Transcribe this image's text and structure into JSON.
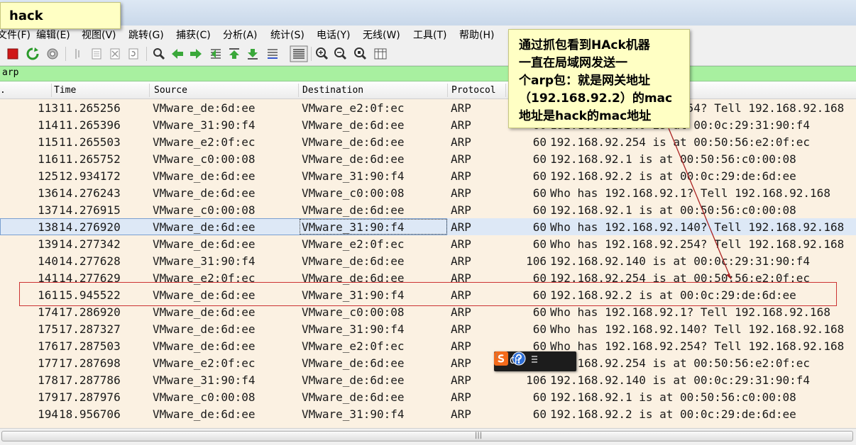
{
  "note": {
    "label": "hack"
  },
  "menu": {
    "items": [
      "文件(F)",
      "编辑(E)",
      "视图(V)",
      "跳转(G)",
      "捕获(C)",
      "分析(A)",
      "统计(S)",
      "电话(Y)",
      "无线(W)",
      "工具(T)",
      "帮助(H)"
    ]
  },
  "filter": {
    "value": "arp"
  },
  "columns": {
    "no": ".",
    "time": "Time",
    "source": "Source",
    "destination": "Destination",
    "protocol": "Protocol"
  },
  "packets": [
    {
      "no": "113",
      "time": "11.265256",
      "src": "VMware_de:6d:ee",
      "dst": "VMware_e2:0f:ec",
      "proto": "ARP",
      "len": "60",
      "info": "Who has 192.168.92.254? Tell 192.168.92.168"
    },
    {
      "no": "114",
      "time": "11.265396",
      "src": "VMware_31:90:f4",
      "dst": "VMware_de:6d:ee",
      "proto": "ARP",
      "len": "60",
      "info": "192.168.92.140 is at 00:0c:29:31:90:f4"
    },
    {
      "no": "115",
      "time": "11.265503",
      "src": "VMware_e2:0f:ec",
      "dst": "VMware_de:6d:ee",
      "proto": "ARP",
      "len": "60",
      "info": "192.168.92.254 is at 00:50:56:e2:0f:ec"
    },
    {
      "no": "116",
      "time": "11.265752",
      "src": "VMware_c0:00:08",
      "dst": "VMware_de:6d:ee",
      "proto": "ARP",
      "len": "60",
      "info": "192.168.92.1 is at 00:50:56:c0:00:08"
    },
    {
      "no": "125",
      "time": "12.934172",
      "src": "VMware_de:6d:ee",
      "dst": "VMware_31:90:f4",
      "proto": "ARP",
      "len": "60",
      "info": "192.168.92.2 is at 00:0c:29:de:6d:ee"
    },
    {
      "no": "136",
      "time": "14.276243",
      "src": "VMware_de:6d:ee",
      "dst": "VMware_c0:00:08",
      "proto": "ARP",
      "len": "60",
      "info": "Who has 192.168.92.1? Tell 192.168.92.168"
    },
    {
      "no": "137",
      "time": "14.276915",
      "src": "VMware_c0:00:08",
      "dst": "VMware_de:6d:ee",
      "proto": "ARP",
      "len": "60",
      "info": "192.168.92.1 is at 00:50:56:c0:00:08"
    },
    {
      "no": "138",
      "time": "14.276920",
      "src": "VMware_de:6d:ee",
      "dst": "VMware_31:90:f4",
      "proto": "ARP",
      "len": "60",
      "info": "Who has 192.168.92.140? Tell 192.168.92.168"
    },
    {
      "no": "139",
      "time": "14.277342",
      "src": "VMware_de:6d:ee",
      "dst": "VMware_e2:0f:ec",
      "proto": "ARP",
      "len": "60",
      "info": "Who has 192.168.92.254? Tell 192.168.92.168"
    },
    {
      "no": "140",
      "time": "14.277628",
      "src": "VMware_31:90:f4",
      "dst": "VMware_de:6d:ee",
      "proto": "ARP",
      "len": "106",
      "info": "192.168.92.140 is at 00:0c:29:31:90:f4"
    },
    {
      "no": "141",
      "time": "14.277629",
      "src": "VMware_e2:0f:ec",
      "dst": "VMware_de:6d:ee",
      "proto": "ARP",
      "len": "60",
      "info": "192.168.92.254 is at 00:50:56:e2:0f:ec"
    },
    {
      "no": "161",
      "time": "15.945522",
      "src": "VMware_de:6d:ee",
      "dst": "VMware_31:90:f4",
      "proto": "ARP",
      "len": "60",
      "info": "192.168.92.2 is at 00:0c:29:de:6d:ee"
    },
    {
      "no": "174",
      "time": "17.286920",
      "src": "VMware_de:6d:ee",
      "dst": "VMware_c0:00:08",
      "proto": "ARP",
      "len": "60",
      "info": "Who has 192.168.92.1? Tell 192.168.92.168"
    },
    {
      "no": "175",
      "time": "17.287327",
      "src": "VMware_de:6d:ee",
      "dst": "VMware_31:90:f4",
      "proto": "ARP",
      "len": "60",
      "info": "Who has 192.168.92.140? Tell 192.168.92.168"
    },
    {
      "no": "176",
      "time": "17.287503",
      "src": "VMware_de:6d:ee",
      "dst": "VMware_e2:0f:ec",
      "proto": "ARP",
      "len": "60",
      "info": "Who has 192.168.92.254? Tell 192.168.92.168"
    },
    {
      "no": "177",
      "time": "17.287698",
      "src": "VMware_e2:0f:ec",
      "dst": "VMware_de:6d:ee",
      "proto": "ARP",
      "len": "60",
      "info": "192.168.92.254 is at 00:50:56:e2:0f:ec"
    },
    {
      "no": "178",
      "time": "17.287786",
      "src": "VMware_31:90:f4",
      "dst": "VMware_de:6d:ee",
      "proto": "ARP",
      "len": "106",
      "info": "192.168.92.140 is at 00:0c:29:31:90:f4"
    },
    {
      "no": "179",
      "time": "17.287976",
      "src": "VMware_c0:00:08",
      "dst": "VMware_de:6d:ee",
      "proto": "ARP",
      "len": "60",
      "info": "192.168.92.1 is at 00:50:56:c0:00:08"
    },
    {
      "no": "194",
      "time": "18.956706",
      "src": "VMware_de:6d:ee",
      "dst": "VMware_31:90:f4",
      "proto": "ARP",
      "len": "60",
      "info": "192.168.92.2 is at 00:0c:29:de:6d:ee"
    }
  ],
  "callout": {
    "lines": [
      "通过抓包看到HAck机器",
      "一直在局域网发送一",
      "个arp包：就是网关地址",
      "（192.168.92.2）的mac",
      "地址是hack的mac地址"
    ]
  },
  "ime": {
    "label": "CH"
  },
  "icons": [
    "stop-capture-icon",
    "restart-capture-icon",
    "capture-options-icon",
    "open-file-icon",
    "save-file-icon",
    "close-file-icon",
    "reload-icon",
    "find-packet-icon",
    "go-back-icon",
    "go-forward-icon",
    "go-to-packet-icon",
    "first-packet-icon",
    "last-packet-icon",
    "auto-scroll-icon",
    "colorize-icon",
    "zoom-in-icon",
    "zoom-out-icon",
    "normal-size-icon",
    "resize-columns-icon"
  ],
  "colors": {
    "row_bg": "#fbf1e2",
    "selected_bg": "#dde8f6",
    "filter_bg": "#a8f0a0",
    "note_bg": "#ffffc4",
    "highlight_border": "#cc3333"
  }
}
